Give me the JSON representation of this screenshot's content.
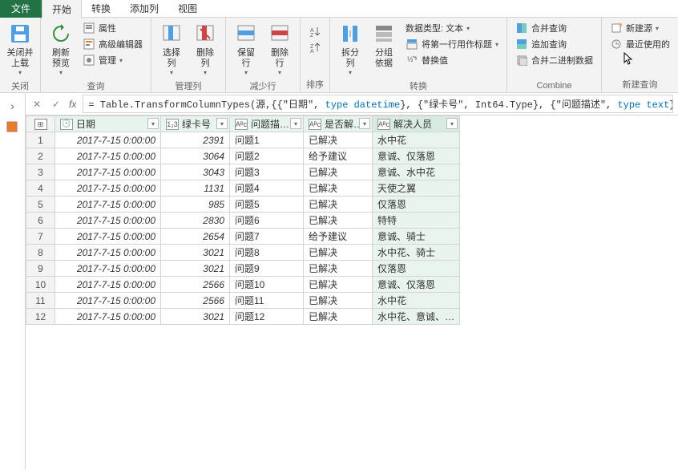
{
  "tabs": {
    "file": "文件",
    "home": "开始",
    "transform": "转换",
    "addcol": "添加列",
    "view": "视图"
  },
  "ribbon": {
    "close": {
      "close_upload": "关闭并\n上载",
      "group": "关闭"
    },
    "query": {
      "refresh": "刷新\n预览",
      "properties": "属性",
      "adv_editor": "高级编辑器",
      "manage": "管理",
      "group": "查询"
    },
    "cols": {
      "select": "选择\n列",
      "remove": "删除\n列",
      "group": "管理列"
    },
    "rows": {
      "keep": "保留\n行",
      "remove": "删除\n行",
      "group": "减少行"
    },
    "sort": {
      "group": "排序"
    },
    "transform": {
      "split": "拆分\n列",
      "groupby": "分组\n依据",
      "datatype": "数据类型: 文本",
      "first_row_header": "将第一行用作标题",
      "replace": "替换值",
      "group": "转换"
    },
    "combine": {
      "merge": "合并查询",
      "append": "追加查询",
      "binary": "合并二进制数据",
      "group": "Combine"
    },
    "newq": {
      "new_source": "新建源",
      "recent": "最近使用的",
      "group": "新建查询"
    }
  },
  "formula": {
    "prefix": "= Table.TransformColumnTypes(源,{{\"日期\", ",
    "t1": "type datetime",
    "mid1": "}, {\"绿卡号\", Int64.Type}, {\"问题描述\", ",
    "t2": "type text",
    "suffix": "}"
  },
  "table": {
    "headers": {
      "date": "日期",
      "card": "绿卡号",
      "issue": "问题描…",
      "solved": "是否解…",
      "person": "解决人员"
    },
    "type_icons": {
      "date": "📅",
      "num": "1₂3",
      "txt": "Aᴮc"
    },
    "rows": [
      {
        "date": "2017-7-15 0:00:00",
        "card": 2391,
        "issue": "问题1",
        "solved": "已解决",
        "person": "水中花"
      },
      {
        "date": "2017-7-15 0:00:00",
        "card": 3064,
        "issue": "问题2",
        "solved": "给予建议",
        "person": "意诚、仅落恩"
      },
      {
        "date": "2017-7-15 0:00:00",
        "card": 3043,
        "issue": "问题3",
        "solved": "已解决",
        "person": "意诚、水中花"
      },
      {
        "date": "2017-7-15 0:00:00",
        "card": 1131,
        "issue": "问题4",
        "solved": "已解决",
        "person": "天使之翼"
      },
      {
        "date": "2017-7-15 0:00:00",
        "card": 985,
        "issue": "问题5",
        "solved": "已解决",
        "person": "仅落恩"
      },
      {
        "date": "2017-7-15 0:00:00",
        "card": 2830,
        "issue": "问题6",
        "solved": "已解决",
        "person": "特特"
      },
      {
        "date": "2017-7-15 0:00:00",
        "card": 2654,
        "issue": "问题7",
        "solved": "给予建议",
        "person": "意诚、骑士"
      },
      {
        "date": "2017-7-15 0:00:00",
        "card": 3021,
        "issue": "问题8",
        "solved": "已解决",
        "person": "水中花、骑士"
      },
      {
        "date": "2017-7-15 0:00:00",
        "card": 3021,
        "issue": "问题9",
        "solved": "已解决",
        "person": "仅落恩"
      },
      {
        "date": "2017-7-15 0:00:00",
        "card": 2566,
        "issue": "问题10",
        "solved": "已解决",
        "person": "意诚、仅落恩"
      },
      {
        "date": "2017-7-15 0:00:00",
        "card": 2566,
        "issue": "问题11",
        "solved": "已解决",
        "person": "水中花"
      },
      {
        "date": "2017-7-15 0:00:00",
        "card": 3021,
        "issue": "问题12",
        "solved": "已解决",
        "person": "水中花、意诚、…"
      }
    ]
  }
}
